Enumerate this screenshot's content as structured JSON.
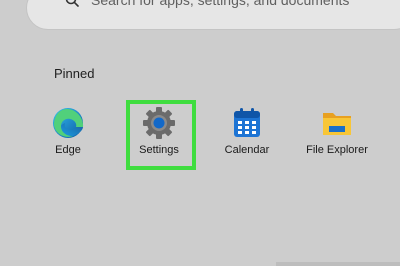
{
  "search": {
    "placeholder": "Search for apps, settings, and documents"
  },
  "pinned": {
    "title": "Pinned",
    "apps": [
      {
        "label": "Edge",
        "icon": "edge-icon"
      },
      {
        "label": "Settings",
        "icon": "gear-icon",
        "highlighted": true
      },
      {
        "label": "Calendar",
        "icon": "calendar-icon"
      },
      {
        "label": "File Explorer",
        "icon": "folder-icon"
      }
    ]
  },
  "colors": {
    "background": "#cdcdcd",
    "highlight": "#3fdd3f"
  }
}
